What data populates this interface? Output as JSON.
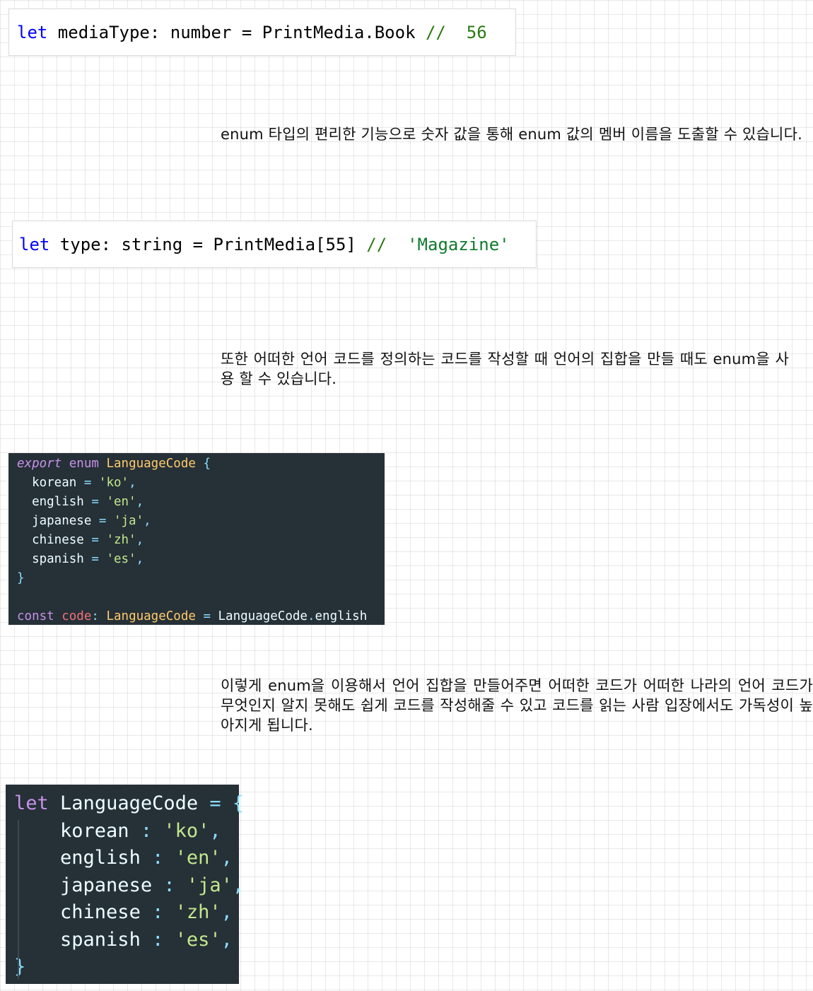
{
  "snippet1": {
    "keyword": "let",
    "code": " mediaType: number = PrintMedia.Book ",
    "comment": "//  56"
  },
  "paragraph1": "enum 타입의 편리한 기능으로 숫자 값을 통해 enum 값의 멤버 이름을 도출할 수 있습니다.",
  "snippet2": {
    "keyword": "let",
    "code": " type: string = PrintMedia[55] ",
    "comment": "//  ",
    "string": "'Magazine'"
  },
  "paragraph2": "또한 어떠한 언어 코드를 정의하는 코드를 작성할 때 언어의 집합을 만들 때도 enum을 사용 할 수 있습니다.",
  "snippet3": {
    "export_kw": "export",
    "enum_kw": "enum",
    "type_name": "LanguageCode",
    "open_brace": "{",
    "close_brace": "}",
    "members": [
      {
        "name": "korean",
        "value": "'ko'"
      },
      {
        "name": "english",
        "value": "'en'"
      },
      {
        "name": "japanese",
        "value": "'ja'"
      },
      {
        "name": "chinese",
        "value": "'zh'"
      },
      {
        "name": "spanish",
        "value": "'es'"
      }
    ],
    "const_kw": "const",
    "var_name": "code",
    "type_ref": "LanguageCode",
    "rhs_obj": "LanguageCode",
    "rhs_prop": "english"
  },
  "paragraph3": "이렇게 enum을 이용해서 언어 집합을 만들어주면 어떠한 코드가 어떠한 나라의 언어 코드가 무엇인지 알지 못해도 쉽게 코드를 작성해줄 수 있고 코드를 읽는 사람 입장에서도 가독성이 높아지게 됩니다.",
  "snippet4": {
    "let_kw": "let",
    "var_name": "LanguageCode",
    "open_brace": "{",
    "close_brace": "}",
    "members": [
      {
        "name": "korean",
        "value": "'ko'"
      },
      {
        "name": "english",
        "value": "'en'"
      },
      {
        "name": "japanese",
        "value": "'ja'"
      },
      {
        "name": "chinese",
        "value": "'zh'"
      },
      {
        "name": "spanish",
        "value": "'es'"
      }
    ]
  }
}
